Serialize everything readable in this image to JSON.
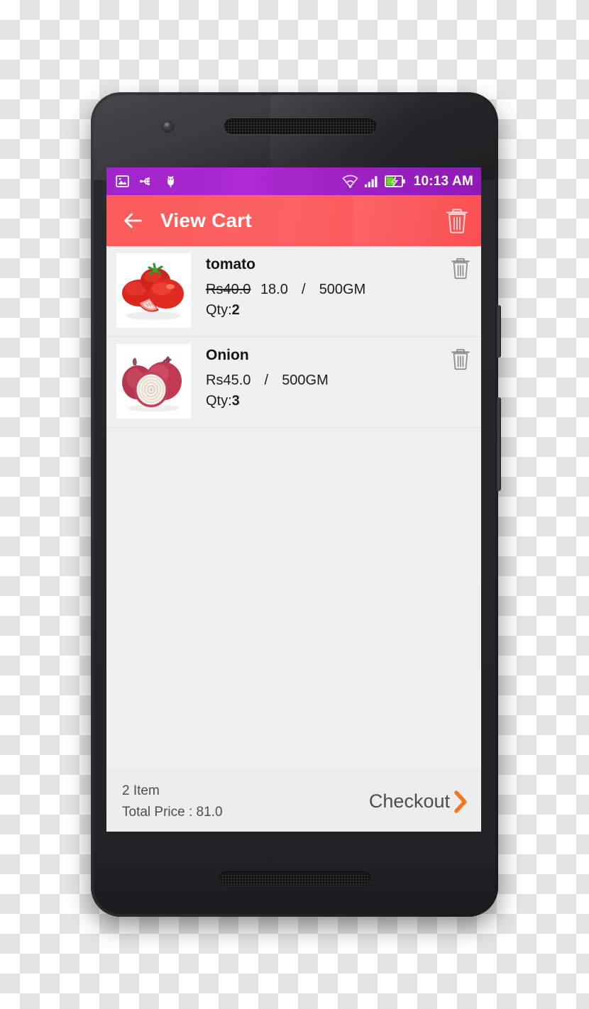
{
  "status_bar": {
    "time": "10:13 AM",
    "left_icons": [
      "image-icon",
      "usb-icon",
      "android-debug-icon"
    ],
    "right_icons": [
      "wifi-icon",
      "signal-icon",
      "battery-charging-icon"
    ],
    "background_color": "#a025c8"
  },
  "app_bar": {
    "back_label": "back-arrow",
    "title": "View Cart",
    "delete_all_label": "delete-all",
    "background_color": "#fb5b5b"
  },
  "cart": {
    "items": [
      {
        "name": "tomato",
        "old_price": "Rs40.0",
        "price": "18.0",
        "separator": "/",
        "unit": "500GM",
        "qty_label": "Qty:",
        "qty": "2",
        "image": "tomato-image",
        "has_discount": true
      },
      {
        "name": "Onion",
        "old_price": "",
        "price": "Rs45.0",
        "separator": "/",
        "unit": "500GM",
        "qty_label": "Qty:",
        "qty": "3",
        "image": "onion-image",
        "has_discount": false
      }
    ]
  },
  "footer": {
    "item_count": "2 Item",
    "total_price": "Total Price : 81.0",
    "checkout_label": "Checkout",
    "chevron_color": "#f07820"
  }
}
